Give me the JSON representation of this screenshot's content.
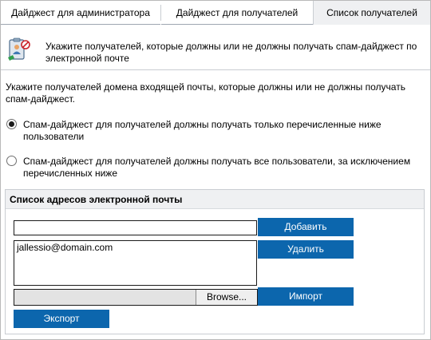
{
  "tabs": [
    {
      "label": "Дайджест для администратора"
    },
    {
      "label": "Дайджест для получателей"
    },
    {
      "label": "Список получателей"
    }
  ],
  "active_tab_index": 2,
  "header": {
    "text": "Укажите получателей, которые должны или не должны получать спам-дайджест по электронной почте",
    "icon": "recipients-list-icon"
  },
  "intro": "Укажите получателей домена входящей почты, которые должны или не должны получать спам-дайджест.",
  "options": [
    {
      "label": "Спам-дайджест для получателей должны получать только перечисленные ниже пользователи",
      "checked": true
    },
    {
      "label": "Спам-дайджест для получателей должны получать все пользователи, за исключением перечисленных ниже",
      "checked": false
    }
  ],
  "panel": {
    "title": "Список адресов электронной почты",
    "email_input_value": "",
    "list_items": [
      "jallessio@domain.com"
    ],
    "add_label": "Добавить",
    "remove_label": "Удалить",
    "browse_label": "Browse...",
    "import_label": "Импорт",
    "export_label": "Экспорт"
  },
  "colors": {
    "button_blue": "#0c66ad",
    "tab_active_bg": "#eff0f2",
    "panel_header_bg": "#eff0f2"
  }
}
